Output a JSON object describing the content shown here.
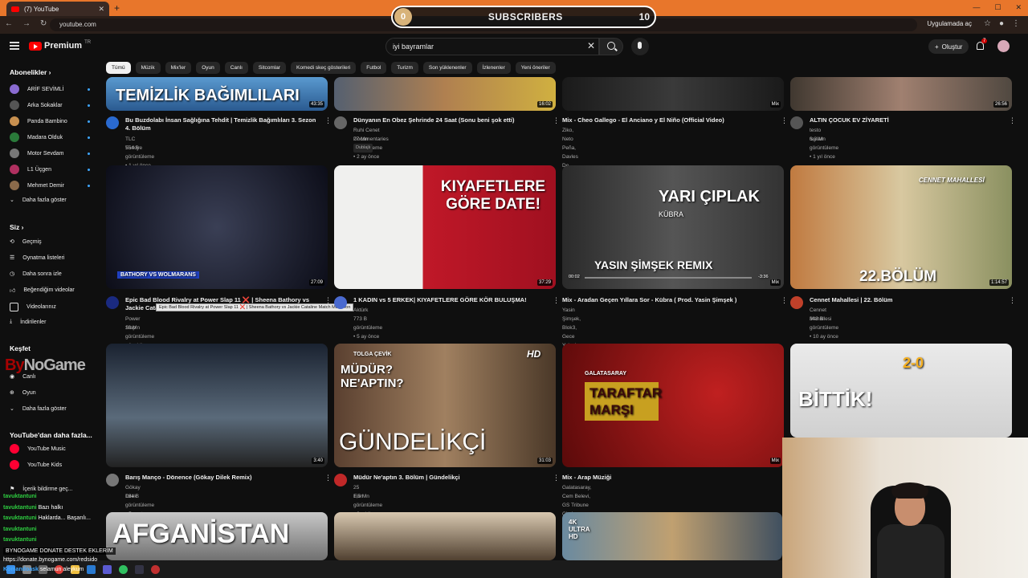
{
  "browser": {
    "tab_title": "(7) YouTube",
    "url": "youtube.com",
    "install_label": "Uygulamada aç"
  },
  "subscriber_overlay": {
    "start": "0",
    "label": "SUBSCRIBERS",
    "goal": "10"
  },
  "header": {
    "logo_text": "Premium",
    "logo_region": "TR",
    "search_value": "iyi bayramlar",
    "create_label": "Oluştur",
    "notification_count": "7"
  },
  "sidebar": {
    "subs_heading": "Abonelikler",
    "subs": [
      "ARİF SEVİMLİ",
      "Arka Sokaklar",
      "Panda Bambino",
      "Madara Olduk",
      "Motor Sevdam",
      "L1 Üçgen",
      "Mehmet Demir"
    ],
    "subs_more": "Daha fazla göster",
    "you_heading": "Siz",
    "you_items": [
      "Geçmiş",
      "Oynatma listeleri",
      "Daha sonra izle",
      "Beğendiğim videolar",
      "Videolarınız",
      "İndirilenler"
    ],
    "explore_heading": "Keşfet",
    "explore_items": [
      "Canlı",
      "Oyun"
    ],
    "explore_more": "Daha fazla göster",
    "more_heading": "YouTube'dan daha fazla...",
    "more_items": [
      "YouTube Music",
      "YouTube Kids"
    ],
    "footer_item": "İçerik bildirme geç..."
  },
  "chips": [
    "Tümü",
    "Müzik",
    "Mix'ler",
    "Oyun",
    "Canlı",
    "Sitcomlar",
    "Komedi skeç gösterileri",
    "Futbol",
    "Turizm",
    "Son yüklenenler",
    "İzlenenler",
    "Yeni öneriler"
  ],
  "videos": [
    {
      "thumb_text": "TEMİZLİK BAĞIMLILARI",
      "duration": "43:35",
      "title": "Bu Buzdolabı İnsan Sağlığına Tehdit | Temizlik Bağımlıları 3. Sezon 4. Bölüm",
      "channel": "TLC Turkiye",
      "meta": "554 B görüntüleme • 1 yıl önce"
    },
    {
      "thumb_text": "",
      "duration": "16:02",
      "title": "Dünyanın En Obez Şehrinde 24 Saat (Sonu beni şok etti)",
      "channel": "Ruhi Cenet Documentaries",
      "meta": "27 Mn görüntüleme • 2 ay önce",
      "badge": "Dublajlı"
    },
    {
      "thumb_text": "",
      "duration": "Mix",
      "title": "Mix - Cheo Gallego - El Anciano y El Niño (Official Video)",
      "channel": "Ziko, Neto Peña, Davles De Novelda ve daha fazlası",
      "meta": ""
    },
    {
      "thumb_text": "",
      "duration": "26:56",
      "title": "ALTIN ÇOCUK EV ZİYARETİ",
      "channel": "testo taylan",
      "meta": "6,3 Mn görüntüleme • 1 yıl önce"
    },
    {
      "thumb_text": "BATHORY VS WOLMARANS",
      "duration": "27:09",
      "title": "Epic Bad Blood Rivalry at Power Slap 11 ❌ | Sheena Bathory vs Jackie Cataline",
      "channel": "Power Slap",
      "meta": "10 Mn görüntüleme • 1 yıl önce"
    },
    {
      "thumb_text": "KIYAFETLERE GÖRE DATE!",
      "duration": "37:29",
      "title": "1 KADIN vs 5 ERKEK| KIYAFETLERE GÖRE KÖR BULUŞMA!",
      "channel": "Aktürk",
      "meta": "773 B görüntüleme • 5 ay önce"
    },
    {
      "thumb_text": "YARI ÇIPLAK",
      "duration": "Mix",
      "title": "Mix - Aradan Geçen Yıllara Sor - Kübra ( Prod. Yasin Şimşek )",
      "channel": "Yasin Şimşek, Blok3, Gece Yolcuları ve daha fazlası",
      "meta": "",
      "thumb_sub": "YASIN ŞİMŞEK REMIX",
      "thumb_small": "KÜBRA",
      "player_start": "00:02",
      "player_end": "-3:36"
    },
    {
      "thumb_text": "22.BÖLÜM",
      "duration": "1:14:57",
      "title": "Cennet Mahallesi | 22. Bölüm",
      "channel": "Cennet Mahallesi",
      "meta": "343 B görüntüleme • 10 ay önce",
      "thumb_top": "CENNET MAHALLESİ"
    },
    {
      "thumb_text": "",
      "duration": "3:40",
      "title": "Barış Manço - Dönence (Gökay Dilek Remix)",
      "channel": "Gökay Dilek",
      "meta": "184 B görüntüleme • 5 saat önce"
    },
    {
      "thumb_text": "GÜNDELİKÇİ",
      "duration": "31:03",
      "title": "Müdür Ne'aptın 3. Bölüm | Gündelikçi",
      "channel": "25 Film",
      "meta": "1,5 Mn görüntüleme • 8 yıl önce",
      "thumb_top": "MÜDÜR? NE'APTIN?",
      "thumb_brand": "TOLGA ÇEVİK",
      "thumb_hd": "HD"
    },
    {
      "thumb_text": "TARAFTAR MARŞI",
      "duration": "Mix",
      "title": "Mix - Arap Müziği",
      "channel": "Galatasaray, Cem Belevi, GS Tribune Choir ve daha fazlası",
      "meta": "",
      "thumb_top": "GALATASARAY"
    },
    {
      "thumb_text": "BİTTİK!",
      "duration": "",
      "title": "",
      "channel": "",
      "meta": "",
      "thumb_score": "2-0"
    },
    {
      "thumb_text": "AFGANİSTAN",
      "duration": "",
      "title": "",
      "channel": "",
      "meta": ""
    },
    {
      "thumb_text": "",
      "duration": "",
      "title": "",
      "channel": "",
      "meta": ""
    },
    {
      "thumb_text": "4K ULTRA HD",
      "duration": "",
      "title": "",
      "channel": "",
      "meta": ""
    }
  ],
  "tooltip": "Epic Bad Blood Rivalry at Power Slap 11 ❌ | Sheena Bathory vs Jackie Cataline Match Marathon",
  "stream": {
    "watermark_a": "By",
    "watermark_b": "NoGame",
    "chat": [
      {
        "user": "tavuktantuni",
        "msg": ""
      },
      {
        "user": "tavuktantuni",
        "msg": "Bazı halkı"
      },
      {
        "user": "tavuktantuni",
        "msg": "Haklarda... Başarılı..."
      },
      {
        "user": "tavuktantuni",
        "msg": ""
      },
      {
        "user": "tavuktantuni",
        "msg": ""
      }
    ],
    "donate_line": "BYNOGAME DONATE DESTEK EKLERİM",
    "donate_url": "https://donate.bynogame.com/redsido",
    "last_user": "Komandoask",
    "last_msg": "selamun aleykum"
  }
}
